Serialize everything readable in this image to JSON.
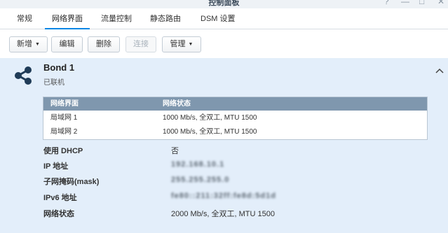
{
  "window": {
    "title": "控制面板",
    "controls": [
      "?",
      "—",
      "□",
      "✕"
    ]
  },
  "tabs": [
    {
      "label": "常规"
    },
    {
      "label": "网络界面",
      "active": true
    },
    {
      "label": "流量控制"
    },
    {
      "label": "静态路由"
    },
    {
      "label": "DSM 设置"
    }
  ],
  "toolbar": {
    "add_label": "新增",
    "edit_label": "编辑",
    "delete_label": "删除",
    "connect_label": "连接",
    "manage_label": "管理"
  },
  "bond": {
    "name": "Bond 1",
    "status": "已联机",
    "icon": "share-icon",
    "collapse_icon": "chevron-up-icon"
  },
  "interfaces": {
    "columns": [
      "网络界面",
      "网络状态"
    ],
    "rows": [
      {
        "name": "局域网 1",
        "status": "1000 Mb/s, 全双工, MTU 1500"
      },
      {
        "name": "局域网 2",
        "status": "1000 Mb/s, 全双工, MTU 1500"
      }
    ]
  },
  "details": {
    "dhcp_label": "使用 DHCP",
    "dhcp_value": "否",
    "ip_label": "IP 地址",
    "ip_value": "192.168.10.1",
    "mask_label": "子网掩码(mask)",
    "mask_value": "255.255.255.0",
    "ipv6_label": "IPv6 地址",
    "ipv6_value": "fe80::211:32ff:fe8d:5d1d",
    "net_status_label": "网络状态",
    "net_status_value": "2000 Mb/s, 全双工, MTU 1500"
  },
  "colors": {
    "accent": "#0086e5",
    "panel_bg": "#e3eefa",
    "table_header": "#7f97ae",
    "icon": "#1f3b57"
  }
}
